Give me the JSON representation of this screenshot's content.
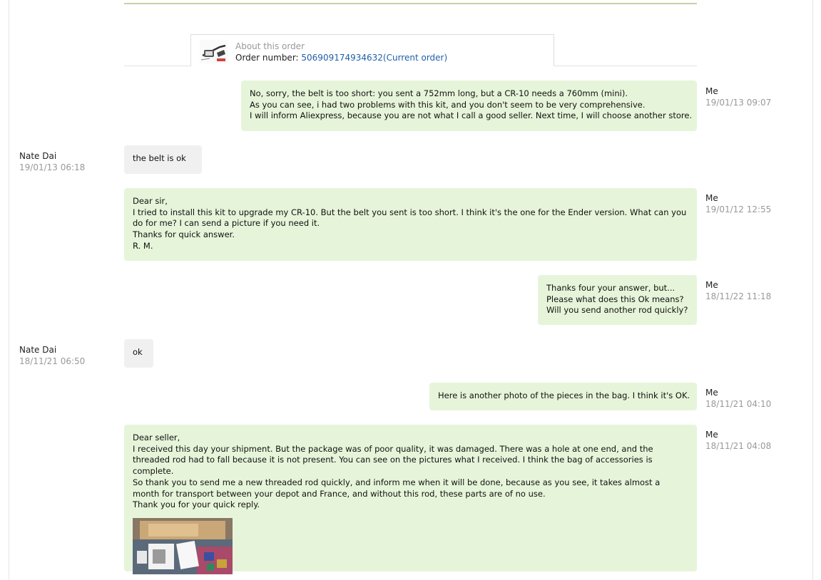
{
  "order": {
    "about": "About this order",
    "number_label": "Order number: ",
    "number_link": "506909174934632(Current order)"
  },
  "messages": [
    {
      "sender": "Me",
      "time": "19/01/13 09:07",
      "lines": [
        "No, sorry, the belt is too short: you sent a 752mm long, but a CR-10 needs a 760mm (mini).",
        "As you can see, i had two problems with this kit, and you don't seem to be very comprehensive.",
        "I will inform Aliexpress, because you are not what I call a good seller. Next time, I will choose another store."
      ]
    },
    {
      "sender": "Nate Dai",
      "time": "19/01/13 06:18",
      "lines": [
        "the belt  is ok"
      ]
    },
    {
      "sender": "Me",
      "time": "19/01/12 12:55",
      "lines": [
        "Dear sir,",
        "I tried to install this kit to upgrade my CR-10. But the belt you sent is too short. I think it's the one for the Ender version. What can you do for me? I can send a picture if you need it.",
        "Thanks for quick answer.",
        "R. M."
      ]
    },
    {
      "sender": "Me",
      "time": "18/11/22 11:18",
      "lines": [
        "Thanks four your answer, but...",
        "Please what does this Ok means?",
        "Will you send another rod quickly?"
      ]
    },
    {
      "sender": "Nate Dai",
      "time": "18/11/21 06:50",
      "lines": [
        "ok"
      ]
    },
    {
      "sender": "Me",
      "time": "18/11/21 04:10",
      "lines": [
        "Here is another photo of the pieces in the bag. I think it's OK."
      ]
    },
    {
      "sender": "Me",
      "time": "18/11/21 04:08",
      "lines": [
        "Dear seller,",
        "I received this day your shipment. But the package was of poor quality, it was damaged. There was a hole at one end, and the threaded rod had to fall because it is not present. You can see on the pictures what I received. I think the bag of accessories is complete.",
        "So thank you to send me a new threaded rod quickly, and inform me when it will be done, because as you see, it takes almost a month for transport between your depot and France, and without this rod, these parts are of no use.",
        "Thank you for your quick reply."
      ]
    }
  ]
}
